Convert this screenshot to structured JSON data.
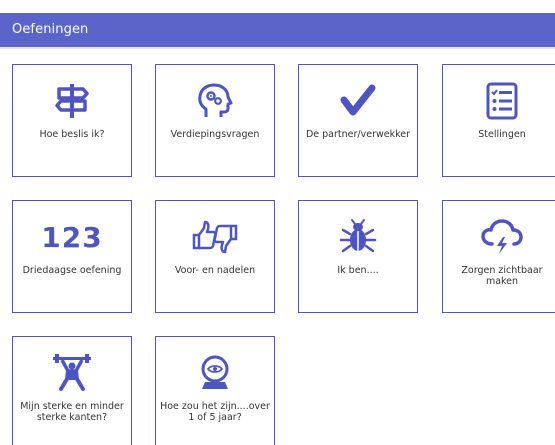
{
  "header": {
    "title": "Oefeningen"
  },
  "accent_color": "#4f55c0",
  "header_color": "#5b64c8",
  "tiles": [
    {
      "label": "Hoe beslis ik?",
      "icon": "signpost-icon"
    },
    {
      "label": "Verdiepingsvragen",
      "icon": "head-gears-icon"
    },
    {
      "label": "De partner/verwekker",
      "icon": "checkmark-icon"
    },
    {
      "label": "Stellingen",
      "icon": "checklist-icon"
    },
    {
      "label": "Driedaagse oefening",
      "icon": "numbers-123-icon",
      "icon_text": "123"
    },
    {
      "label": "Voor- en nadelen",
      "icon": "thumbs-up-down-icon"
    },
    {
      "label": "Ik ben....",
      "icon": "bug-icon"
    },
    {
      "label": "Zorgen zichtbaar maken",
      "icon": "storm-cloud-icon"
    },
    {
      "label": "Mijn sterke en minder sterke kanten?",
      "icon": "weightlifter-icon"
    },
    {
      "label": "Hoe zou het zijn....over 1 of 5 jaar?",
      "icon": "crystal-ball-icon"
    }
  ]
}
